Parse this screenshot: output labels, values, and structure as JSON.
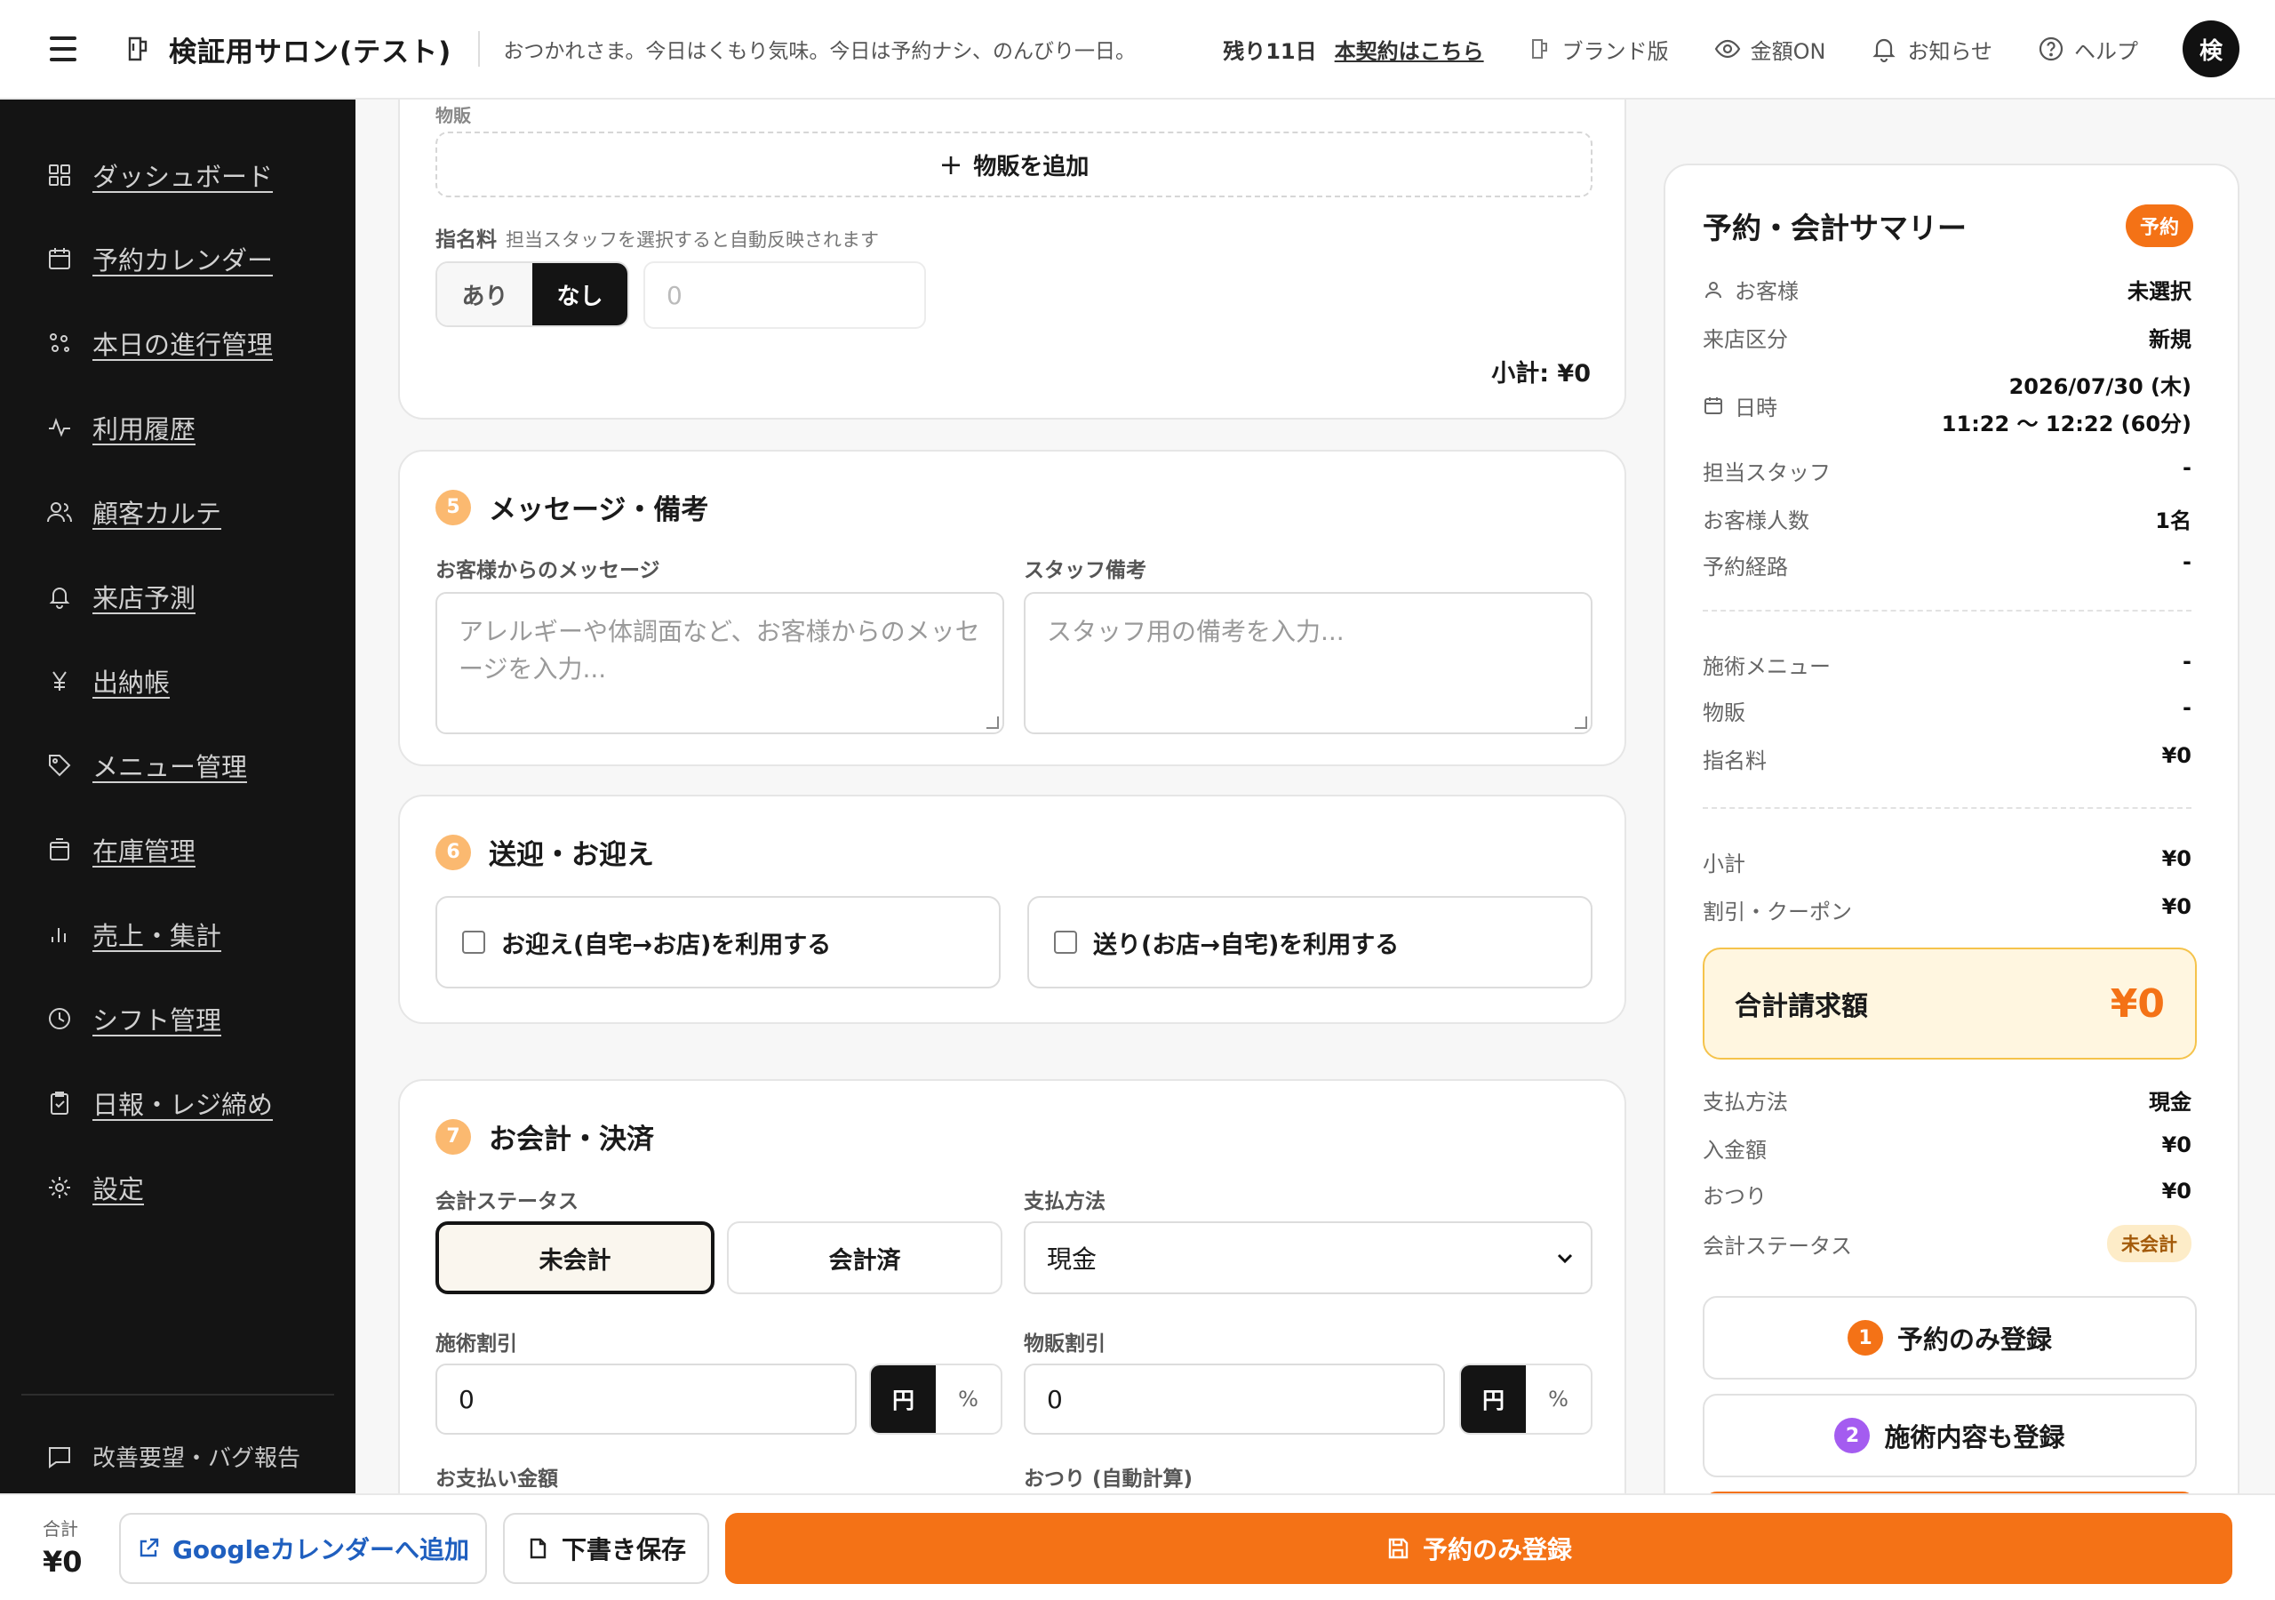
{
  "header": {
    "salon_name": "検証用サロン(テスト)",
    "greeting": "おつかれさま。今日はくもり気味。今日は予約ナシ、のんびり一日。",
    "trial_days": "残り11日",
    "trial_link": "本契約はこちら",
    "brand": "ブランド版",
    "amount_toggle": "金額ON",
    "notifications": "お知らせ",
    "help": "ヘルプ",
    "avatar_initial": "検"
  },
  "sidebar": {
    "items": [
      {
        "label": "ダッシュボード",
        "icon": "grid-icon"
      },
      {
        "label": "予約カレンダー",
        "icon": "calendar-icon"
      },
      {
        "label": "本日の進行管理",
        "icon": "flow-icon"
      },
      {
        "label": "利用履歴",
        "icon": "activity-icon"
      },
      {
        "label": "顧客カルテ",
        "icon": "users-icon"
      },
      {
        "label": "来店予測",
        "icon": "bell-icon"
      },
      {
        "label": "出納帳",
        "icon": "yen-icon"
      },
      {
        "label": "メニュー管理",
        "icon": "tag-icon"
      },
      {
        "label": "在庫管理",
        "icon": "box-icon"
      },
      {
        "label": "売上・集計",
        "icon": "bar-chart-icon"
      },
      {
        "label": "シフト管理",
        "icon": "clock-icon"
      },
      {
        "label": "日報・レジ締め",
        "icon": "clipboard-icon"
      },
      {
        "label": "設定",
        "icon": "gear-icon"
      }
    ],
    "feedback": "改善要望・バグ報告"
  },
  "form": {
    "cut_label": "物販",
    "add_goods": "物販を追加",
    "nomination_label": "指名料",
    "nomination_note": "担当スタッフを選択すると自動反映されます",
    "nomination_yes": "あり",
    "nomination_no": "なし",
    "nomination_amount_placeholder": "0",
    "subtotal": "小計: ¥0",
    "sec5": {
      "num": "5",
      "title": "メッセージ・備考"
    },
    "customer_message_label": "お客様からのメッセージ",
    "customer_message_placeholder": "アレルギーや体調面など、お客様からのメッセージを入力...",
    "staff_note_label": "スタッフ備考",
    "staff_note_placeholder": "スタッフ用の備考を入力...",
    "sec6": {
      "num": "6",
      "title": "送迎・お迎え"
    },
    "pickup": "お迎え(自宅→お店)を利用する",
    "dropoff": "送り(お店→自宅)を利用する",
    "sec7": {
      "num": "7",
      "title": "お会計・決済"
    },
    "payment_status_label": "会計ステータス",
    "status_unpaid": "未会計",
    "status_paid": "会計済",
    "payment_method_label": "支払方法",
    "payment_method_value": "現金",
    "service_discount_label": "施術割引",
    "service_discount_value": "0",
    "goods_discount_label": "物販割引",
    "goods_discount_value": "0",
    "unit_yen": "円",
    "unit_pct": "%",
    "paid_amount_label": "お支払い金額",
    "change_label": "おつり (自動計算)"
  },
  "summary": {
    "title": "予約・会計サマリー",
    "badge": "予約",
    "customer_k": "お客様",
    "customer_v": "未選択",
    "visit_type_k": "来店区分",
    "visit_type_v": "新規",
    "datetime_k": "日時",
    "date_v": "2026/07/30 (木)",
    "time_v": "11:22 〜 12:22 (60分)",
    "staff_k": "担当スタッフ",
    "staff_v": "-",
    "guests_k": "お客様人数",
    "guests_v": "1名",
    "route_k": "予約経路",
    "route_v": "-",
    "menu_k": "施術メニュー",
    "menu_v": "-",
    "goods_k": "物販",
    "goods_v": "-",
    "nomination_k": "指名料",
    "nomination_v": "¥0",
    "subtotal_k": "小計",
    "subtotal_v": "¥0",
    "discount_k": "割引・クーポン",
    "discount_v": "¥0",
    "total_k": "合計請求額",
    "total_v": "¥0",
    "method_k": "支払方法",
    "method_v": "現金",
    "deposit_k": "入金額",
    "deposit_v": "¥0",
    "change_k": "おつり",
    "change_v": "¥0",
    "status_k": "会計ステータス",
    "status_v": "未会計",
    "btn1_num": "1",
    "btn1": "予約のみ登録",
    "btn2_num": "2",
    "btn2": "施術内容も登録"
  },
  "bottom": {
    "total_label": "合計",
    "total_value": "¥0",
    "gcal": "Googleカレンダーへ追加",
    "draft": "下書き保存",
    "submit": "予約のみ登録"
  },
  "colors": {
    "accent": "#f47216",
    "badge_orange": "#f47216",
    "section_num": "#fbb970",
    "purple": "#a45cf0",
    "link_blue": "#1f5fbf"
  }
}
